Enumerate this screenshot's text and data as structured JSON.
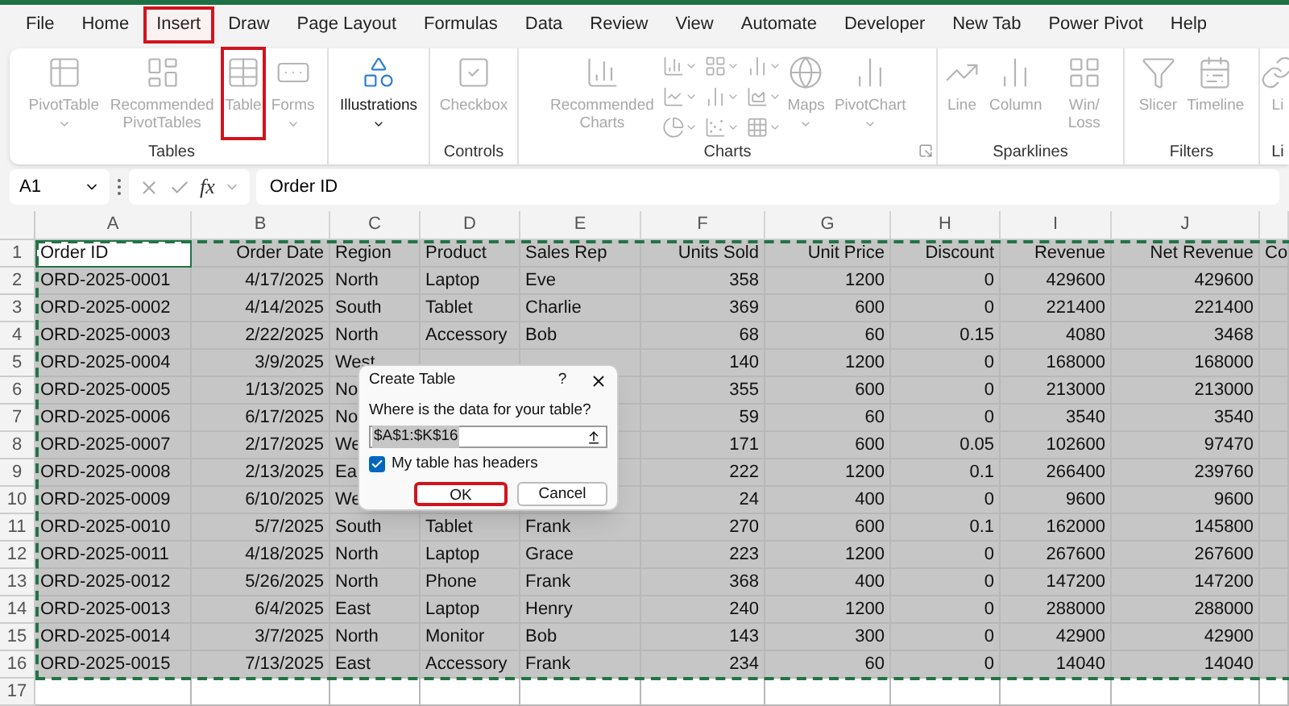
{
  "menu_tabs": [
    {
      "label": "File",
      "selected": false
    },
    {
      "label": "Home",
      "selected": false
    },
    {
      "label": "Insert",
      "selected": true
    },
    {
      "label": "Draw",
      "selected": false
    },
    {
      "label": "Page Layout",
      "selected": false
    },
    {
      "label": "Formulas",
      "selected": false
    },
    {
      "label": "Data",
      "selected": false
    },
    {
      "label": "Review",
      "selected": false
    },
    {
      "label": "View",
      "selected": false
    },
    {
      "label": "Automate",
      "selected": false
    },
    {
      "label": "Developer",
      "selected": false
    },
    {
      "label": "New Tab",
      "selected": false
    },
    {
      "label": "Power Pivot",
      "selected": false
    },
    {
      "label": "Help",
      "selected": false
    }
  ],
  "ribbon_groups": [
    {
      "label": "Tables",
      "items": [
        {
          "kind": "pivot",
          "label": "PivotTable",
          "dropdown": true,
          "disabled": true,
          "highlighted": false
        },
        {
          "kind": "recpivot",
          "label": "Recommended PivotTables",
          "dropdown": false,
          "disabled": true,
          "highlighted": false
        },
        {
          "kind": "table",
          "label": "Table",
          "dropdown": false,
          "disabled": true,
          "highlighted": true
        },
        {
          "kind": "forms",
          "label": "Forms",
          "dropdown": true,
          "disabled": true,
          "highlighted": false
        }
      ]
    },
    {
      "items": [
        {
          "kind": "illustrations",
          "label": "Illustrations",
          "dropdown": true,
          "disabled": false,
          "highlighted": false
        }
      ]
    },
    {
      "label": "Controls",
      "items": [
        {
          "kind": "checkbox",
          "label": "Checkbox",
          "dropdown": false,
          "disabled": true,
          "highlighted": false
        }
      ]
    },
    {
      "label": "Charts",
      "launcher": true,
      "items": [
        {
          "kind": "recchart",
          "label": "Recommended Charts",
          "dropdown": false,
          "disabled": true,
          "highlighted": false
        },
        {
          "kind": "chartgrid",
          "disabled": true
        },
        {
          "kind": "maps",
          "label": "Maps",
          "dropdown": true,
          "disabled": true,
          "highlighted": false
        },
        {
          "kind": "pivotchart",
          "label": "PivotChart",
          "dropdown": true,
          "disabled": true,
          "highlighted": false
        }
      ]
    },
    {
      "label": "Sparklines",
      "items": [
        {
          "kind": "line",
          "label": "Line",
          "dropdown": false,
          "disabled": true,
          "highlighted": false
        },
        {
          "kind": "column",
          "label": "Column",
          "dropdown": false,
          "disabled": true,
          "highlighted": false
        },
        {
          "kind": "winloss",
          "label": "Win/ Loss",
          "dropdown": false,
          "disabled": true,
          "highlighted": false
        }
      ]
    },
    {
      "label": "Filters",
      "items": [
        {
          "kind": "slicer",
          "label": "Slicer",
          "dropdown": false,
          "disabled": true,
          "highlighted": false
        },
        {
          "kind": "timeline",
          "label": "Timeline",
          "dropdown": false,
          "disabled": true,
          "highlighted": false
        }
      ]
    },
    {
      "label": "Li",
      "items": [
        {
          "kind": "link",
          "label": "Li",
          "dropdown": false,
          "disabled": true,
          "highlighted": false
        }
      ]
    }
  ],
  "formula_bar": {
    "name_box": "A1",
    "fx": "fx",
    "formula": "Order ID"
  },
  "columns": [
    {
      "letter": "A",
      "kind": "text"
    },
    {
      "letter": "B",
      "kind": "number"
    },
    {
      "letter": "C",
      "kind": "text"
    },
    {
      "letter": "D",
      "kind": "text"
    },
    {
      "letter": "E",
      "kind": "text"
    },
    {
      "letter": "F",
      "kind": "number"
    },
    {
      "letter": "G",
      "kind": "number"
    },
    {
      "letter": "H",
      "kind": "number"
    },
    {
      "letter": "I",
      "kind": "number"
    },
    {
      "letter": "J",
      "kind": "number"
    },
    {
      "kind": "text"
    }
  ],
  "rows": [
    {
      "number": "1",
      "first_cell_active": true,
      "selected": true,
      "cells": [
        "Order ID",
        "Order Date",
        "Region",
        "Product",
        "Sales Rep",
        "Units Sold",
        "Unit Price",
        "Discount",
        "Revenue",
        "Net Revenue",
        "Co"
      ]
    },
    {
      "number": "2",
      "first_cell_active": false,
      "selected": true,
      "cells": [
        "ORD-2025-0001",
        "4/17/2025",
        "North",
        "Laptop",
        "Eve",
        "358",
        "1200",
        "0",
        "429600",
        "429600",
        null
      ]
    },
    {
      "number": "3",
      "first_cell_active": false,
      "selected": true,
      "cells": [
        "ORD-2025-0002",
        "4/14/2025",
        "South",
        "Tablet",
        "Charlie",
        "369",
        "600",
        "0",
        "221400",
        "221400",
        null
      ]
    },
    {
      "number": "4",
      "first_cell_active": false,
      "selected": true,
      "cells": [
        "ORD-2025-0003",
        "2/22/2025",
        "North",
        "Accessory",
        "Bob",
        "68",
        "60",
        "0.15",
        "4080",
        "3468",
        null
      ]
    },
    {
      "number": "5",
      "first_cell_active": false,
      "selected": true,
      "cells": [
        "ORD-2025-0004",
        "3/9/2025",
        "West",
        null,
        null,
        "140",
        "1200",
        "0",
        "168000",
        "168000",
        null
      ]
    },
    {
      "number": "6",
      "first_cell_active": false,
      "selected": true,
      "cells": [
        "ORD-2025-0005",
        "1/13/2025",
        "No",
        null,
        null,
        "355",
        "600",
        "0",
        "213000",
        "213000",
        null
      ]
    },
    {
      "number": "7",
      "first_cell_active": false,
      "selected": true,
      "cells": [
        "ORD-2025-0006",
        "6/17/2025",
        "No",
        null,
        null,
        "59",
        "60",
        "0",
        "3540",
        "3540",
        null
      ]
    },
    {
      "number": "8",
      "first_cell_active": false,
      "selected": true,
      "cells": [
        "ORD-2025-0007",
        "2/17/2025",
        "We",
        null,
        null,
        "171",
        "600",
        "0.05",
        "102600",
        "97470",
        null
      ]
    },
    {
      "number": "9",
      "first_cell_active": false,
      "selected": true,
      "cells": [
        "ORD-2025-0008",
        "2/13/2025",
        "Ea",
        null,
        null,
        "222",
        "1200",
        "0.1",
        "266400",
        "239760",
        null
      ]
    },
    {
      "number": "10",
      "first_cell_active": false,
      "selected": true,
      "cells": [
        "ORD-2025-0009",
        "6/10/2025",
        "We",
        null,
        null,
        "24",
        "400",
        "0",
        "9600",
        "9600",
        null
      ]
    },
    {
      "number": "11",
      "first_cell_active": false,
      "selected": true,
      "cells": [
        "ORD-2025-0010",
        "5/7/2025",
        "South",
        "Tablet",
        "Frank",
        "270",
        "600",
        "0.1",
        "162000",
        "145800",
        null
      ]
    },
    {
      "number": "12",
      "first_cell_active": false,
      "selected": true,
      "cells": [
        "ORD-2025-0011",
        "4/18/2025",
        "North",
        "Laptop",
        "Grace",
        "223",
        "1200",
        "0",
        "267600",
        "267600",
        null
      ]
    },
    {
      "number": "13",
      "first_cell_active": false,
      "selected": true,
      "cells": [
        "ORD-2025-0012",
        "5/26/2025",
        "North",
        "Phone",
        "Frank",
        "368",
        "400",
        "0",
        "147200",
        "147200",
        null
      ]
    },
    {
      "number": "14",
      "first_cell_active": false,
      "selected": true,
      "cells": [
        "ORD-2025-0013",
        "6/4/2025",
        "East",
        "Laptop",
        "Henry",
        "240",
        "1200",
        "0",
        "288000",
        "288000",
        null
      ]
    },
    {
      "number": "15",
      "first_cell_active": false,
      "selected": true,
      "cells": [
        "ORD-2025-0014",
        "3/7/2025",
        "North",
        "Monitor",
        "Bob",
        "143",
        "300",
        "0",
        "42900",
        "42900",
        null
      ]
    },
    {
      "number": "16",
      "first_cell_active": false,
      "selected": true,
      "cells": [
        "ORD-2025-0015",
        "7/13/2025",
        "East",
        "Accessory",
        "Frank",
        "234",
        "60",
        "0",
        "14040",
        "14040",
        null
      ]
    },
    {
      "number": "17",
      "first_cell_active": false,
      "selected": false,
      "cells": [
        null,
        null,
        null,
        null,
        null,
        null,
        null,
        null,
        null,
        null,
        null
      ]
    }
  ],
  "dialog": {
    "title": "Create Table",
    "help": "?",
    "prompt": "Where is the data for your table?",
    "range": "$A$1:$K$16",
    "headers_label": "My table has headers",
    "headers_checked": true,
    "ok": "OK",
    "ok_highlighted": true,
    "cancel": "Cancel"
  }
}
